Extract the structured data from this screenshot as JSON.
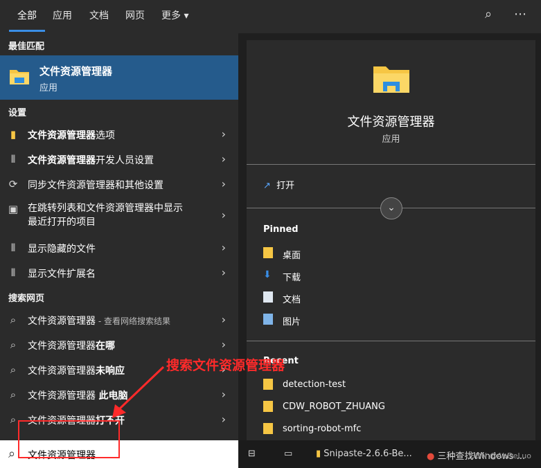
{
  "tabs": [
    "全部",
    "应用",
    "文档",
    "网页",
    "更多 ▾"
  ],
  "sections": {
    "best": "最佳匹配",
    "settings": "设置",
    "web": "搜索网页"
  },
  "best_match": {
    "title": "文件资源管理器",
    "subtitle": "应用"
  },
  "settings_items": [
    {
      "bold": "文件资源管理器",
      "rest": "选项",
      "icon": "folder-icon"
    },
    {
      "bold": "文件资源管理器",
      "rest": "开发人员设置",
      "icon": "developer-icon"
    },
    {
      "text": "同步文件资源管理器和其他设置",
      "icon": "sync-icon"
    },
    {
      "text": "在跳转列表和文件资源管理器中显示\n最近打开的项目",
      "icon": "display-icon"
    },
    {
      "text": "显示隐藏的文件",
      "icon": "developer-icon"
    },
    {
      "text": "显示文件扩展名",
      "icon": "developer-icon"
    }
  ],
  "web_items": [
    {
      "text": "文件资源管理器",
      "suffix": " - 查看网络搜索结果"
    },
    {
      "text": "文件资源管理器",
      "bold": "在哪"
    },
    {
      "text": "文件资源管理器",
      "bold": "未响应"
    },
    {
      "text": "文件资源管理器 ",
      "bold": "此电脑"
    },
    {
      "text": "文件资源管理器",
      "bold": "打不开"
    }
  ],
  "search": {
    "value": "文件资源管理器"
  },
  "preview": {
    "name": "文件资源管理器",
    "type": "应用",
    "open": "打开"
  },
  "pinned": {
    "heading": "Pinned",
    "items": [
      "桌面",
      "下载",
      "文档",
      "图片"
    ]
  },
  "recent": {
    "heading": "Recent",
    "items": [
      "detection-test",
      "CDW_ROBOT_ZHUANG",
      "sorting-robot-mfc"
    ]
  },
  "annotation": "搜索文件资源管理器",
  "taskbar": {
    "item1": "Snipaste-2.6.6-Be...",
    "item2": "三种查找Windows ..."
  },
  "watermark": "CSDN @AbDeLuo",
  "colors": {
    "accent": "#255b8c",
    "annotation": "#ff2a2a"
  }
}
